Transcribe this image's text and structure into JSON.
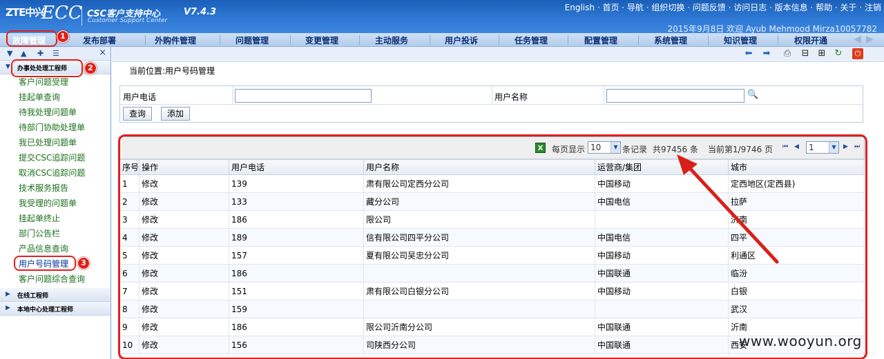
{
  "header": {
    "logo_brand": "ZTE中兴",
    "logo_app": "ECC",
    "title_cn": "CSC客户支持中心",
    "title_en": "Customer Support Center",
    "version": "V7.4.3",
    "links": "English · 首页 · 导航 · 组织切换 · 问题反馈 · 访问日志 · 版本信息 · 帮助 · 关于 · 注销",
    "user_line": "2015年9月8日 欢迎 Ayub Mehmood Mirza10057782"
  },
  "menu": {
    "items": [
      "故障管理",
      "发布部署",
      "外购件管理",
      "问题管理",
      "变更管理",
      "主动服务",
      "用户投诉",
      "任务管理",
      "配置管理",
      "系统管理",
      "知识管理",
      "权限开通"
    ]
  },
  "sidebar": {
    "tools": [
      "▼",
      "▲",
      "✚",
      "☰",
      "×"
    ],
    "groups": [
      {
        "label": "办事处处理工程师",
        "expanded": true
      },
      {
        "label": "在线工程师",
        "expanded": false
      },
      {
        "label": "本地中心处理工程师",
        "expanded": false
      }
    ],
    "items": [
      "客户问题受理",
      "挂起单查询",
      "待我处理问题单",
      "待部门协助处理单",
      "我已处理问题单",
      "提交CSC追踪问题",
      "取消CSC追踪问题",
      "技术服务报告",
      "我受理的问题单",
      "挂起单终止",
      "部门公告栏",
      "产品信息查询",
      "用户号码管理",
      "客户问题综合查询"
    ]
  },
  "annotations": [
    "1",
    "2",
    "3"
  ],
  "breadcrumb": "当前位置:用户号码管理",
  "search": {
    "phone_label": "用户电话",
    "name_label": "用户名称",
    "phone_value": "",
    "name_value": "",
    "query_button": "查询",
    "add_button": "添加"
  },
  "pager": {
    "per_page_label": "每页显示",
    "per_page_value": "10",
    "records_suffix": "条记录",
    "total": "共97456 条",
    "current": "当前第1/9746 页",
    "page_value": "1",
    "nav": [
      "⏮",
      "◀",
      "▶",
      "⏭"
    ]
  },
  "table": {
    "columns": [
      "序号",
      "操作",
      "用户电话",
      "用户名称",
      "运营商/集团",
      "城市"
    ],
    "rows": [
      {
        "no": "1",
        "op": "修改",
        "phone": "139",
        "name": "肃有限公司定西分公司",
        "carrier": "中国移动",
        "city": "定西地区(定西县)"
      },
      {
        "no": "2",
        "op": "修改",
        "phone": "133",
        "name": "藏分公司",
        "carrier": "中国电信",
        "city": "拉萨"
      },
      {
        "no": "3",
        "op": "修改",
        "phone": "186",
        "name": "限公司",
        "carrier": "",
        "city": "济南"
      },
      {
        "no": "4",
        "op": "修改",
        "phone": "189",
        "name": "信有限公司四平分公司",
        "carrier": "中国电信",
        "city": "四平"
      },
      {
        "no": "5",
        "op": "修改",
        "phone": "157",
        "name": "夏有限公司吴忠分公司",
        "carrier": "中国移动",
        "city": "利通区"
      },
      {
        "no": "6",
        "op": "修改",
        "phone": "186",
        "name": "",
        "carrier": "中国联通",
        "city": "临汾"
      },
      {
        "no": "7",
        "op": "修改",
        "phone": "151",
        "name": "肃有限公司白银分公司",
        "carrier": "中国移动",
        "city": "白银"
      },
      {
        "no": "8",
        "op": "修改",
        "phone": "159",
        "name": "",
        "carrier": "",
        "city": "武汉"
      },
      {
        "no": "9",
        "op": "修改",
        "phone": "186",
        "name": "限公司沂南分公司",
        "carrier": "中国联通",
        "city": "沂南"
      },
      {
        "no": "10",
        "op": "修改",
        "phone": "156",
        "name": "司陕西分公司",
        "carrier": "中国联通",
        "city": "西安"
      }
    ]
  },
  "watermark": "www.wooyun.org",
  "colors": {
    "accent": "#1a5fb8",
    "annotation": "#e0201a",
    "link_green": "#1a6f1a"
  }
}
